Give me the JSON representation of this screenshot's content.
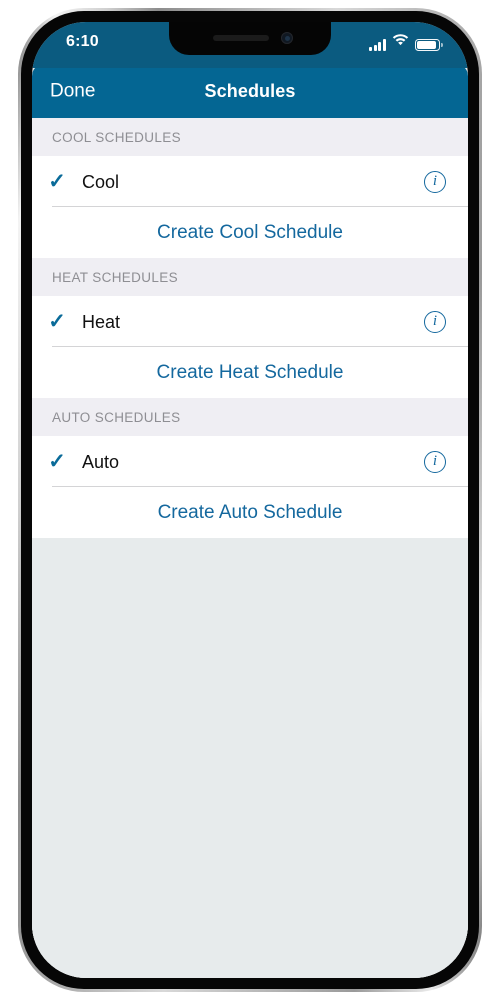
{
  "status_bar": {
    "time": "6:10",
    "signal_icon": "cellular-signal-icon",
    "wifi_icon": "wifi-icon",
    "battery_icon": "battery-icon"
  },
  "nav_bar": {
    "done_label": "Done",
    "title": "Schedules"
  },
  "sections": [
    {
      "header": "COOL SCHEDULES",
      "rows": [
        {
          "checkmark": "✓",
          "title": "Cool",
          "info_label": "i"
        }
      ],
      "action": "Create Cool Schedule"
    },
    {
      "header": "HEAT SCHEDULES",
      "rows": [
        {
          "checkmark": "✓",
          "title": "Heat",
          "info_label": "i"
        }
      ],
      "action": "Create Heat Schedule"
    },
    {
      "header": "AUTO SCHEDULES",
      "rows": [
        {
          "checkmark": "✓",
          "title": "Auto",
          "info_label": "i"
        }
      ],
      "action": "Create Auto Schedule"
    }
  ],
  "colors": {
    "nav_bar": "#046693",
    "status_bar": "#0b5b80",
    "accent_link": "#14689e",
    "checkmark": "#0a6b99",
    "section_header_bg": "#efeef3",
    "table_bg": "#e7ebec",
    "cell_bg": "#ffffff",
    "separator": "#d4d4d6",
    "section_header_text": "#8e8e93"
  }
}
